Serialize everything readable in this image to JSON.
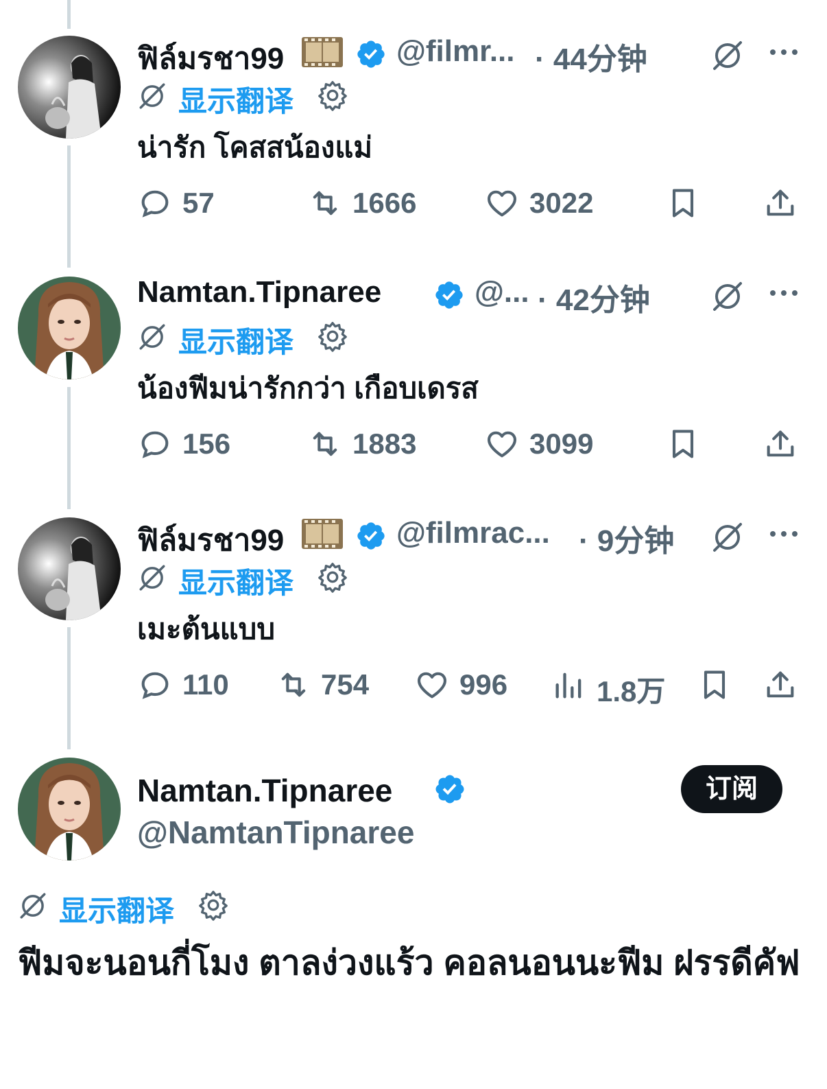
{
  "tweets": [
    {
      "name": "ฟิล์มรชา99",
      "handle": "@filmr...",
      "time": "· 44分钟",
      "translate_label": "显示翻译",
      "text": "น่ารัก โคสสน้องแม่",
      "replies": "57",
      "retweets": "1666",
      "likes": "3022",
      "avatar": "bw-woman-avatar",
      "emoji": "film-frames-emoji"
    },
    {
      "name": "Namtan.Tipnaree",
      "handle": "@...",
      "time": "· 42分钟",
      "translate_label": "显示翻译",
      "text": "น้องฟีมน่ารักกว่า เกือบเดรส",
      "replies": "156",
      "retweets": "1883",
      "likes": "3099",
      "avatar": "color-woman-avatar"
    },
    {
      "name": "ฟิล์มรชา99",
      "handle": "@filmrac...",
      "time": "· 9分钟",
      "translate_label": "显示翻译",
      "text": "เมะต้นแบบ",
      "replies": "110",
      "retweets": "754",
      "likes": "996",
      "views": "1.8万",
      "avatar": "bw-woman-avatar",
      "emoji": "film-frames-emoji"
    }
  ],
  "main_post": {
    "name": "Namtan.Tipnaree",
    "handle": "@NamtanTipnaree",
    "subscribe_label": "订阅",
    "translate_label": "显示翻译",
    "text": "ฟีมจะนอนกี่โมง ตาลง่วงแร้ว คอลนอนนะฟีม ฝรรดีคัฟ"
  },
  "colors": {
    "accent": "#1d9bf0",
    "text": "#0f1419",
    "secondary": "#536471",
    "thread_line": "#cfd9de"
  }
}
